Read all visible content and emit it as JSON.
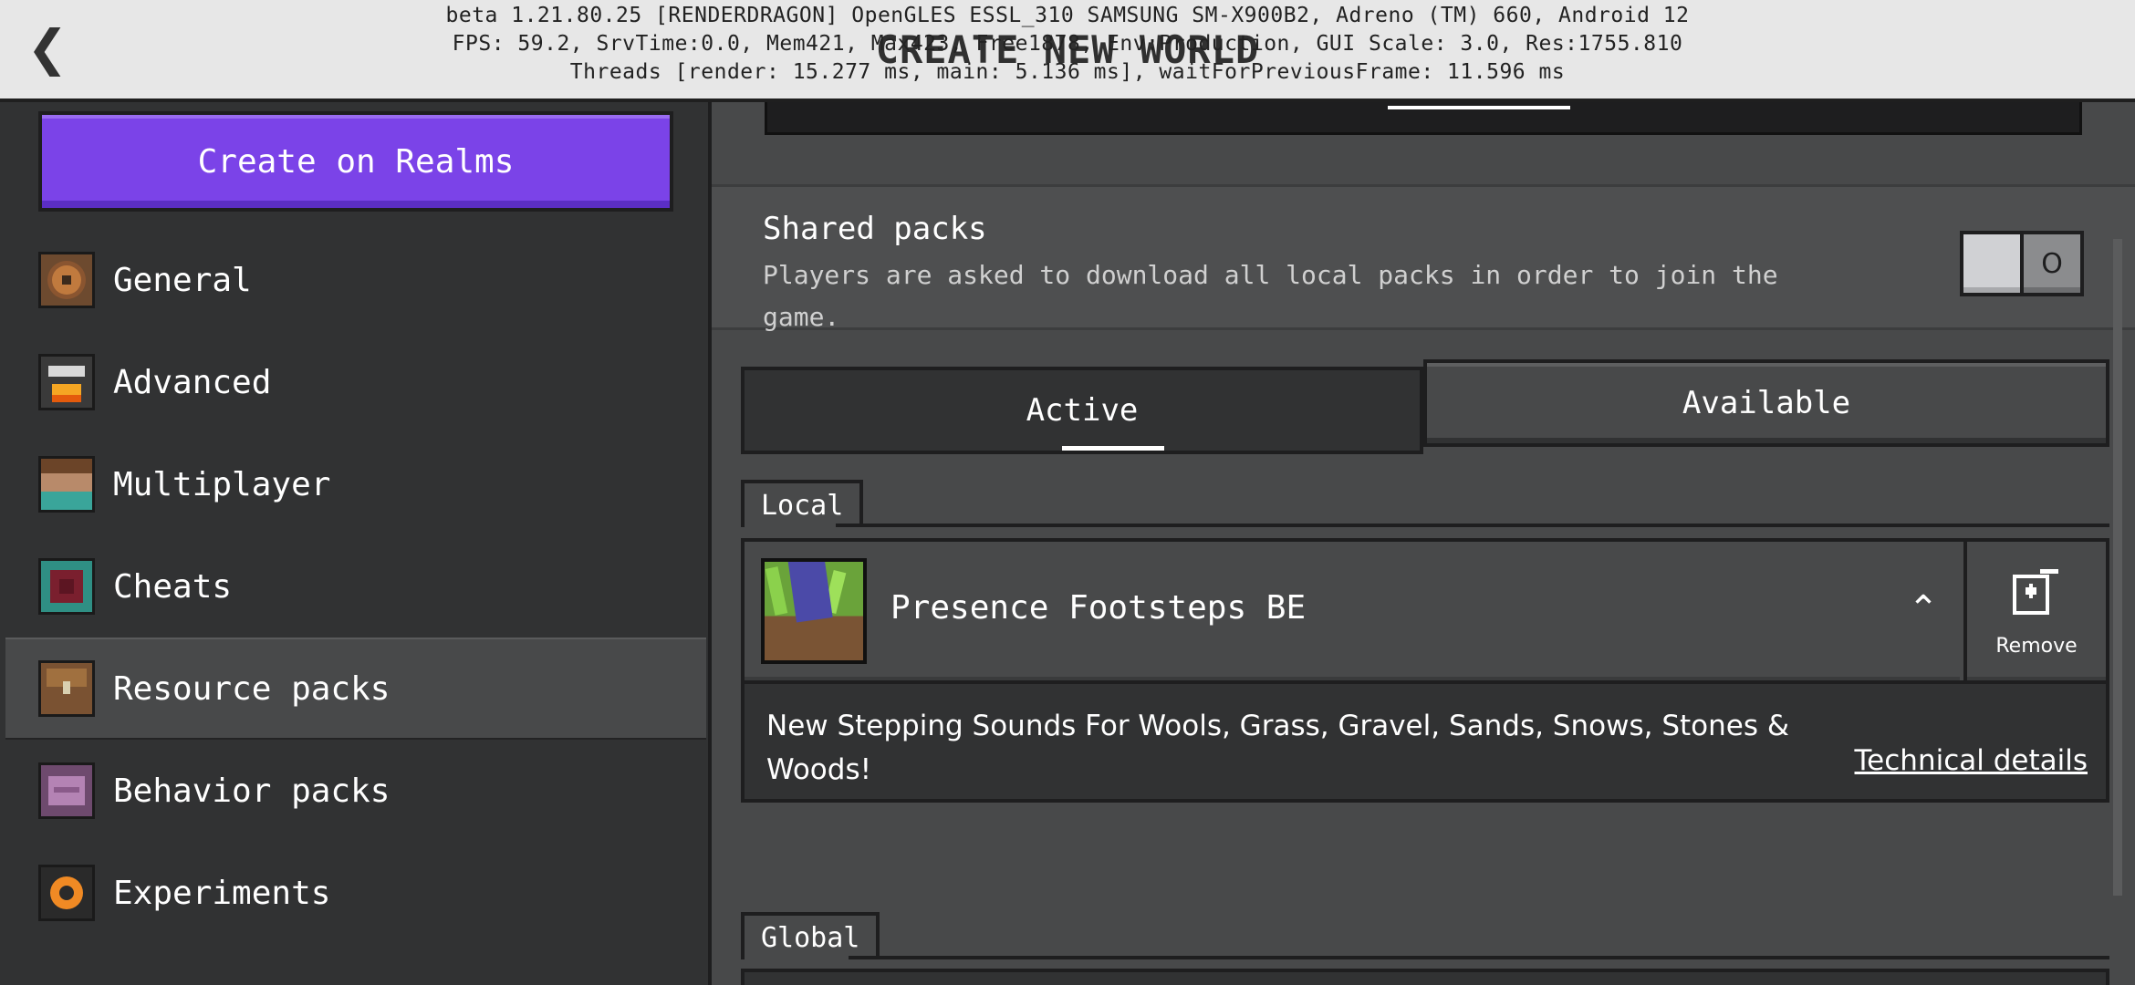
{
  "header": {
    "title": "CREATE NEW WORLD",
    "debug_line1": "beta 1.21.80.25 [RENDERDRAGON] OpenGLES ESSL_310 SAMSUNG SM-X900B2, Adreno (TM) 660, Android 12",
    "debug_line2": "FPS: 59.2, SrvTime:0.0, Mem421, Max423, Free1878, Env:Production, GUI Scale: 3.0, Res:1755.810",
    "debug_line3": "Threads [render: 15.277 ms, main: 5.136 ms], waitForPreviousFrame: 11.596 ms",
    "back_icon": "chevron-left-icon"
  },
  "sidebar": {
    "realms_button": "Create on Realms",
    "items": [
      {
        "label": "General",
        "icon": "gear-icon"
      },
      {
        "label": "Advanced",
        "icon": "furnace-icon"
      },
      {
        "label": "Multiplayer",
        "icon": "player-head-icon"
      },
      {
        "label": "Cheats",
        "icon": "command-block-icon"
      },
      {
        "label": "Resource packs",
        "icon": "chest-icon"
      },
      {
        "label": "Behavior packs",
        "icon": "behavior-pack-icon"
      },
      {
        "label": "Experiments",
        "icon": "experiment-icon"
      }
    ],
    "selected_index": 4
  },
  "main": {
    "shared_packs": {
      "title": "Shared packs",
      "description": "Players are asked to download all local packs in order to join the game.",
      "toggle_state": "off",
      "toggle_on_glyph": "O"
    },
    "tabs": [
      {
        "label": "Active",
        "selected": true
      },
      {
        "label": "Available",
        "selected": false
      }
    ],
    "local_label": "Local",
    "pack": {
      "name": "Presence Footsteps BE",
      "description": "New Stepping Sounds For Wools, Grass, Gravel, Sands, Snows, Stones & Woods!",
      "remove_label": "Remove",
      "technical_details": "Technical details",
      "expand_icon": "chevron-up-icon"
    },
    "global_label": "Global"
  },
  "colors": {
    "realms_purple": "#7b43e8",
    "panel": "#48494a",
    "sidebar": "#313233",
    "border": "#1e1e1f"
  }
}
